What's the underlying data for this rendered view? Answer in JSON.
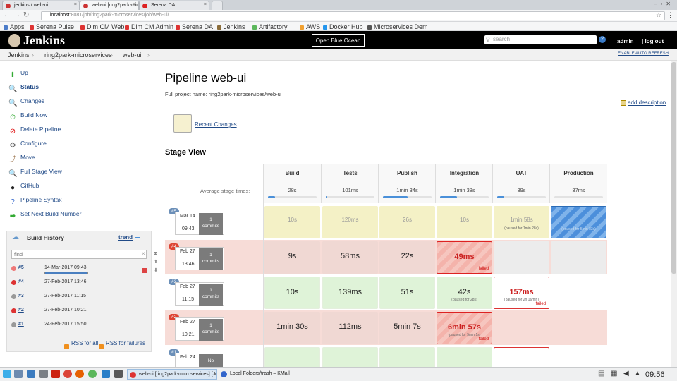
{
  "browser": {
    "tabs": [
      {
        "title": "jenkins / web-ui",
        "color": "#c33"
      },
      {
        "title": "web-ui [ring2park-mic",
        "color": "#c33"
      },
      {
        "title": "Serena DA",
        "color": "#d22"
      }
    ],
    "url_host": "localhost",
    "url_path": ":8081/job/ring2park-microservices/job/web-ui/",
    "bookmarks": [
      {
        "label": "Apps",
        "color": "#4c7cc9"
      },
      {
        "label": "Serena Pulse",
        "color": "#d33"
      },
      {
        "label": "Dim CM Web",
        "color": "#d33"
      },
      {
        "label": "Dim CM Admin",
        "color": "#d33"
      },
      {
        "label": "Serena DA",
        "color": "#d33"
      },
      {
        "label": "Jenkins",
        "color": "#8a6d3b"
      },
      {
        "label": "Artifactory",
        "color": "#5cb85c"
      },
      {
        "label": "AWS",
        "color": "#f0a030"
      },
      {
        "label": "Docker Hub",
        "color": "#2496ed"
      },
      {
        "label": "Microservices Dem",
        "color": "#555"
      }
    ]
  },
  "jenkins": {
    "logo": "Jenkins",
    "blue_ocean": "Open Blue Ocean",
    "search_placeholder": "search",
    "help": "?",
    "user": "admin",
    "logout": "| log out",
    "auto_refresh": "ENABLE AUTO REFRESH",
    "breadcrumbs": [
      "Jenkins",
      "ring2park-microservices",
      "web-ui"
    ]
  },
  "tasks": [
    {
      "label": "Up",
      "icon": "up-arrow-icon",
      "glyph": "⬆",
      "color": "#3a3"
    },
    {
      "label": "Status",
      "icon": "magnifier-icon",
      "glyph": "🔍",
      "color": "#336"
    },
    {
      "label": "Changes",
      "icon": "notepad-icon",
      "glyph": "🔍",
      "color": "#336"
    },
    {
      "label": "Build Now",
      "icon": "clock-play-icon",
      "glyph": "⏱",
      "color": "#3a3"
    },
    {
      "label": "Delete Pipeline",
      "icon": "no-entry-icon",
      "glyph": "⊘",
      "color": "#d00"
    },
    {
      "label": "Configure",
      "icon": "gear-icon",
      "glyph": "⚙",
      "color": "#666"
    },
    {
      "label": "Move",
      "icon": "move-icon",
      "glyph": "⤴",
      "color": "#a86"
    },
    {
      "label": "Full Stage View",
      "icon": "magnifier-icon",
      "glyph": "🔍",
      "color": "#336"
    },
    {
      "label": "GitHub",
      "icon": "github-icon",
      "glyph": "●",
      "color": "#222"
    },
    {
      "label": "Pipeline Syntax",
      "icon": "help-icon",
      "glyph": "?",
      "color": "#36c"
    },
    {
      "label": "Set Next Build Number",
      "icon": "next-arrow-icon",
      "glyph": "➡",
      "color": "#3a3"
    }
  ],
  "build_history": {
    "title": "Build History",
    "trend": "trend",
    "find_placeholder": "find",
    "builds": [
      {
        "num": "#5",
        "date": "14-Mar-2017 09:43",
        "status": "running"
      },
      {
        "num": "#4",
        "date": "27-Feb-2017 13:46",
        "status": "failed"
      },
      {
        "num": "#3",
        "date": "27-Feb-2017 11:15",
        "status": "aborted"
      },
      {
        "num": "#2",
        "date": "27-Feb-2017 10:21",
        "status": "failed"
      },
      {
        "num": "#1",
        "date": "24-Feb-2017 15:50",
        "status": "aborted"
      }
    ],
    "rss_all": "RSS for all",
    "rss_failures": "RSS for failures"
  },
  "main": {
    "title": "Pipeline web-ui",
    "full_name": "Full project name: ring2park-microservices/web-ui",
    "add_description": "add description",
    "recent_changes": "Recent Changes",
    "stage_view_title": "Stage View",
    "avg_label": "Average stage times:"
  },
  "stages": [
    {
      "name": "Build",
      "avg": "28s",
      "avg_progress": 0.15
    },
    {
      "name": "Tests",
      "avg": "101ms",
      "avg_progress": 0.02
    },
    {
      "name": "Publish",
      "avg": "1min 34s",
      "avg_progress": 0.5
    },
    {
      "name": "Integration",
      "avg": "1min 38s",
      "avg_progress": 0.35
    },
    {
      "name": "UAT",
      "avg": "39s",
      "avg_progress": 0.15
    },
    {
      "name": "Production",
      "avg": "37ms",
      "avg_progress": 0
    }
  ],
  "runs": [
    {
      "num": "#5",
      "badge_color": "#6b8fb8",
      "row_bg": "#fff",
      "date": "Mar 14",
      "time": "09:43",
      "commits": "1\ncommits",
      "cells": [
        {
          "dur": "10s",
          "cls": "pend",
          "note": "",
          "fail": ""
        },
        {
          "dur": "120ms",
          "cls": "pend",
          "note": "",
          "fail": ""
        },
        {
          "dur": "26s",
          "cls": "pend",
          "note": "",
          "fail": ""
        },
        {
          "dur": "10s",
          "cls": "pend",
          "note": "",
          "fail": ""
        },
        {
          "dur": "1min 58s",
          "cls": "pend",
          "note": "(paused for 1min 28s)",
          "fail": ""
        },
        {
          "dur": "",
          "cls": "run",
          "note": "(paused for 5min 33s)",
          "fail": ""
        }
      ]
    },
    {
      "num": "#4",
      "badge_color": "#d43",
      "row_bg": "#f7dcd7",
      "date": "Feb 27",
      "time": "13:46",
      "commits": "1\ncommits",
      "cells": [
        {
          "dur": "9s",
          "cls": "fai",
          "note": "",
          "fail": ""
        },
        {
          "dur": "58ms",
          "cls": "fai",
          "note": "",
          "fail": ""
        },
        {
          "dur": "22s",
          "cls": "fai",
          "note": "",
          "fail": ""
        },
        {
          "dur": "49ms",
          "cls": "failstripe",
          "note": "",
          "fail": "failed"
        },
        {
          "dur": "",
          "cls": "empty",
          "note": "",
          "fail": ""
        },
        {
          "dur": "",
          "cls": "empty",
          "note": "",
          "fail": ""
        }
      ]
    },
    {
      "num": "#3",
      "badge_color": "#6b8fb8",
      "row_bg": "#fff",
      "date": "Feb 27",
      "time": "11:15",
      "commits": "1\ncommits",
      "cells": [
        {
          "dur": "10s",
          "cls": "succ",
          "note": "",
          "fail": ""
        },
        {
          "dur": "139ms",
          "cls": "succ",
          "note": "",
          "fail": ""
        },
        {
          "dur": "51s",
          "cls": "succ",
          "note": "",
          "fail": ""
        },
        {
          "dur": "42s",
          "cls": "succ",
          "note": "(paused for 28s)",
          "fail": ""
        },
        {
          "dur": "157ms",
          "cls": "failw",
          "note": "(paused for 2h 16min)",
          "fail": "failed"
        },
        {
          "dur": "",
          "cls": "none",
          "note": "",
          "fail": ""
        }
      ]
    },
    {
      "num": "#2",
      "badge_color": "#d43",
      "row_bg": "#f7dcd7",
      "date": "Feb 27",
      "time": "10:21",
      "commits": "1\ncommits",
      "cells": [
        {
          "dur": "1min 30s",
          "cls": "fai",
          "note": "",
          "fail": ""
        },
        {
          "dur": "112ms",
          "cls": "fai",
          "note": "",
          "fail": ""
        },
        {
          "dur": "5min 7s",
          "cls": "fai",
          "note": "",
          "fail": ""
        },
        {
          "dur": "6min 57s",
          "cls": "failstripe",
          "note": "(paused for 5min 1s)",
          "fail": "failed"
        },
        {
          "dur": "",
          "cls": "none",
          "note": "",
          "fail": ""
        },
        {
          "dur": "",
          "cls": "none",
          "note": "",
          "fail": ""
        }
      ]
    },
    {
      "num": "#1",
      "badge_color": "#6b8fb8",
      "row_bg": "#fff",
      "date": "Feb 24",
      "time": "",
      "commits": "No",
      "cells": [
        {
          "dur": "",
          "cls": "succ",
          "note": "",
          "fail": ""
        },
        {
          "dur": "",
          "cls": "succ",
          "note": "",
          "fail": ""
        },
        {
          "dur": "",
          "cls": "succ",
          "note": "",
          "fail": ""
        },
        {
          "dur": "",
          "cls": "succ",
          "note": "",
          "fail": ""
        },
        {
          "dur": "",
          "cls": "failw",
          "note": "",
          "fail": ""
        },
        {
          "dur": "",
          "cls": "none",
          "note": "",
          "fail": ""
        }
      ]
    }
  ],
  "taskbar": {
    "tasks": [
      {
        "label": "web-ui [ring2park-microservices] [Je",
        "color": "#d33"
      },
      {
        "label": "Local Folders/trash – KMail",
        "color": "#36c"
      }
    ],
    "clock": "09:56"
  }
}
